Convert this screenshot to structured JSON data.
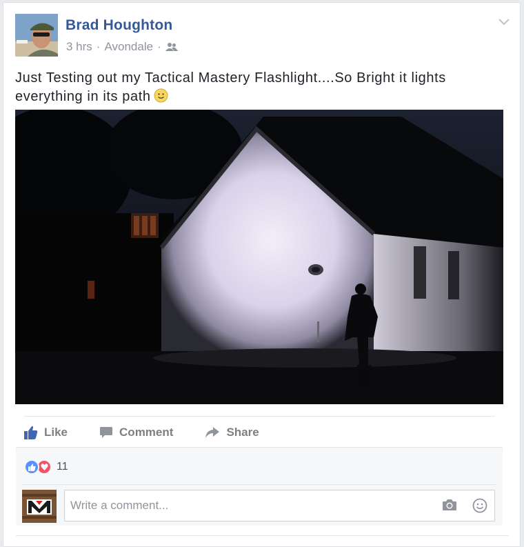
{
  "post": {
    "author": "Brad Houghton",
    "time": "3 hrs",
    "separator": "·",
    "location": "Avondale",
    "text": "Just Testing out my Tactical Mastery Flashlight....So Bright it lights everything in its path",
    "audience_icon": "friends-icon",
    "options_icon": "chevron-down-icon"
  },
  "actions": {
    "like_label": "Like",
    "comment_label": "Comment",
    "share_label": "Share"
  },
  "reactions": {
    "types": [
      "like",
      "love"
    ],
    "count": "11"
  },
  "comment_input": {
    "placeholder": "Write a comment...",
    "value": ""
  },
  "colors": {
    "author_blue": "#365899",
    "meta_gray": "#90949c",
    "action_gray": "#7f7f7f",
    "like_blue": "#4267b2",
    "love_red": "#f25268"
  }
}
